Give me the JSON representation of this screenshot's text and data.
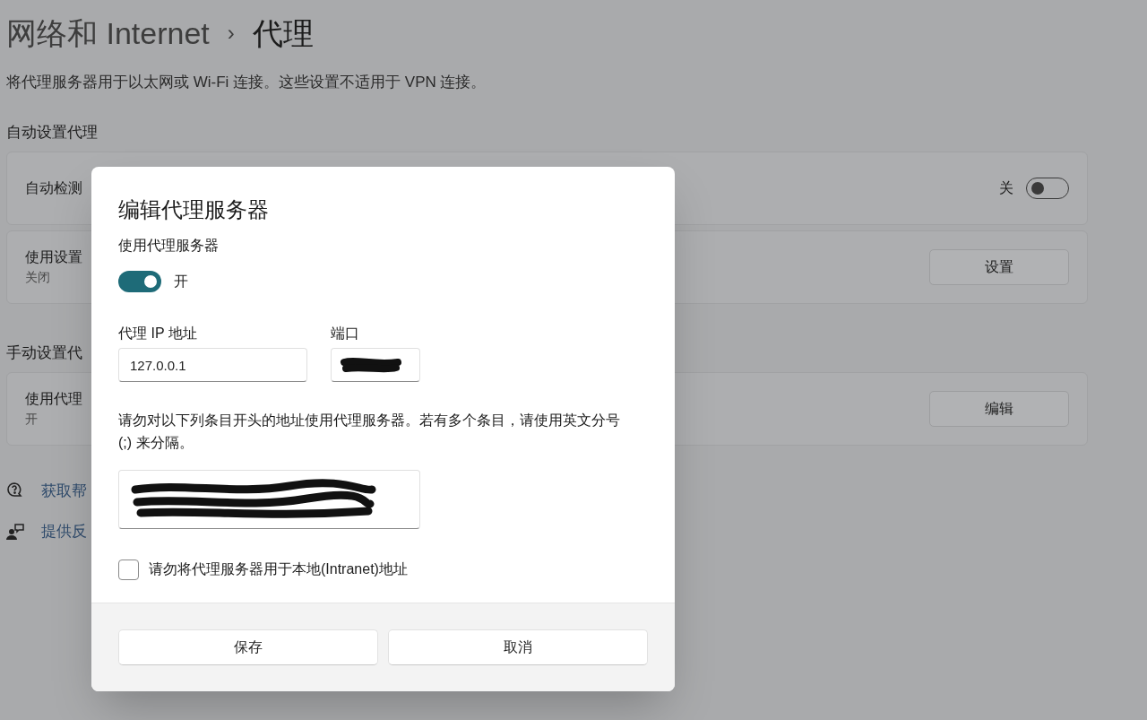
{
  "breadcrumb": {
    "parent": "网络和 Internet",
    "separator": "›",
    "current": "代理"
  },
  "description": "将代理服务器用于以太网或 Wi-Fi 连接。这些设置不适用于 VPN 连接。",
  "sections": [
    {
      "heading": "自动设置代理",
      "cards": [
        {
          "kind": "toggle",
          "title": "自动检测",
          "state_label": "关",
          "on": false
        },
        {
          "kind": "button",
          "title": "使用设置",
          "subtitle": "关闭",
          "button": "设置"
        }
      ]
    },
    {
      "heading": "手动设置代",
      "cards": [
        {
          "kind": "button",
          "title": "使用代理",
          "subtitle": "开",
          "button": "编辑"
        }
      ]
    }
  ],
  "links": [
    {
      "kind": "help",
      "label": "获取帮"
    },
    {
      "kind": "feedback",
      "label": "提供反"
    }
  ],
  "dialog": {
    "title": "编辑代理服务器",
    "proxy_switch": {
      "label": "使用代理服务器",
      "on": true,
      "state_label": "开"
    },
    "ip_field": {
      "label": "代理 IP 地址",
      "value": "127.0.0.1"
    },
    "port_field": {
      "label": "端口",
      "redacted": true
    },
    "exceptions": {
      "instructions": "请勿对以下列条目开头的地址使用代理服务器。若有多个条目，请使用英文分号 (;) 来分隔。",
      "redacted": true
    },
    "intranet_checkbox": {
      "label": "请勿将代理服务器用于本地(Intranet)地址",
      "checked": false
    },
    "buttons": [
      "保存",
      "取消"
    ]
  }
}
